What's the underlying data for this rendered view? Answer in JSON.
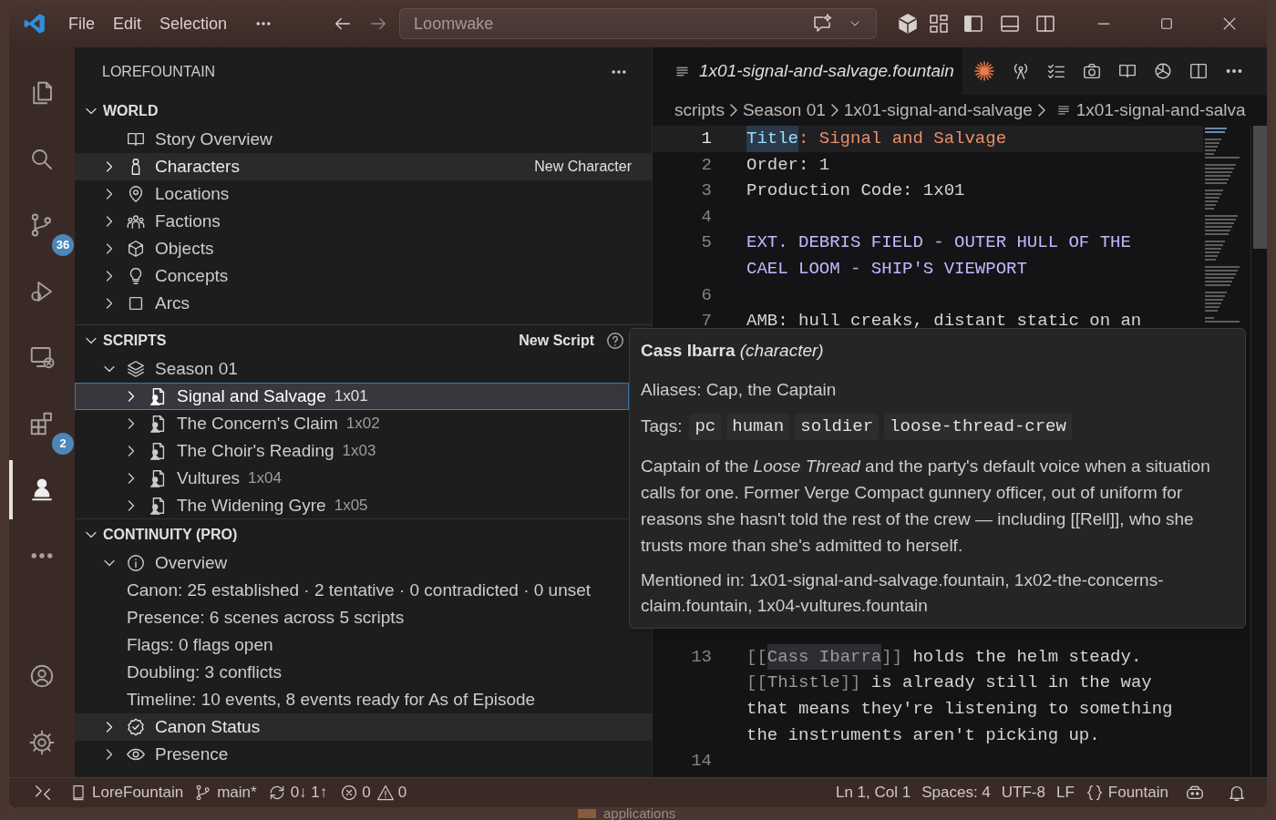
{
  "title_bar": {
    "menus": [
      "File",
      "Edit",
      "Selection"
    ],
    "search": "Loomwake"
  },
  "activity_bar": {
    "items": [
      {
        "kind": "explorer",
        "selected": false
      },
      {
        "kind": "search",
        "selected": false
      },
      {
        "kind": "source_control",
        "selected": false,
        "badge": "36"
      },
      {
        "kind": "run",
        "selected": false
      },
      {
        "kind": "remote",
        "selected": false
      },
      {
        "kind": "extensions",
        "selected": false,
        "badge": "2"
      },
      {
        "kind": "lorefountain",
        "selected": true
      },
      {
        "kind": "more",
        "selected": false
      }
    ],
    "bottom": [
      {
        "kind": "accounts"
      },
      {
        "kind": "settings"
      }
    ]
  },
  "sidebar": {
    "title": "LOREFOUNTAIN",
    "sections": [
      {
        "title": "WORLD",
        "expanded": true,
        "items": [
          {
            "kind": "overview",
            "label": "Story Overview",
            "hovered": false
          },
          {
            "kind": "characters",
            "label": "Characters",
            "expanded": false,
            "hovered": true,
            "action": "New Character"
          },
          {
            "kind": "locations",
            "label": "Locations",
            "expanded": false,
            "hovered": false
          },
          {
            "kind": "factions",
            "label": "Factions",
            "expanded": false,
            "hovered": false
          },
          {
            "kind": "objects",
            "label": "Objects",
            "expanded": false,
            "hovered": false
          },
          {
            "kind": "concepts",
            "label": "Concepts",
            "expanded": false,
            "hovered": false
          },
          {
            "kind": "arcs",
            "label": "Arcs",
            "expanded": false,
            "hovered": false
          }
        ]
      },
      {
        "title": "SCRIPTS",
        "expanded": true,
        "action": "New Script",
        "items": [
          {
            "kind": "season",
            "label": "Season 01",
            "expanded": true,
            "hovered": false,
            "children": [
              {
                "kind": "script",
                "label": "Signal and Salvage",
                "code": "1x01",
                "expanded": false,
                "selected": true
              },
              {
                "kind": "script",
                "label": "The Concern's Claim",
                "code": "1x02",
                "expanded": false,
                "selected": false
              },
              {
                "kind": "script",
                "label": "The Choir's Reading",
                "code": "1x03",
                "expanded": false,
                "selected": false
              },
              {
                "kind": "script",
                "label": "Vultures",
                "code": "1x04",
                "expanded": false,
                "selected": false
              },
              {
                "kind": "script",
                "label": "The Widening Gyre",
                "code": "1x05",
                "expanded": false,
                "selected": false
              }
            ]
          }
        ]
      },
      {
        "title": "CONTINUITY (PRO)",
        "expanded": true,
        "items": [
          {
            "kind": "overview_stats",
            "label": "Overview",
            "expanded": true,
            "hovered": false,
            "children": [
              {
                "kind": "stat",
                "label": "Canon: 25 established · 2 tentative · 0 contradicted · 0 unset"
              },
              {
                "kind": "stat",
                "label": "Presence: 6 scenes across 5 scripts"
              },
              {
                "kind": "stat",
                "label": "Flags: 0 flags open"
              },
              {
                "kind": "stat",
                "label": "Doubling: 3 conflicts"
              },
              {
                "kind": "stat",
                "label": "Timeline: 10 events, 8 events ready for As of Episode"
              }
            ]
          },
          {
            "kind": "canon",
            "label": "Canon Status",
            "expanded": false,
            "hovered": true
          },
          {
            "kind": "presence",
            "label": "Presence",
            "expanded": false,
            "hovered": false
          }
        ]
      }
    ]
  },
  "editor": {
    "tab": {
      "label": "1x01-signal-and-salvage.fountain",
      "preview": true
    },
    "breadcrumbs": [
      "scripts",
      "Season 01",
      "1x01-signal-and-salvage",
      "1x01-signal-and-salva"
    ],
    "rows_top": [
      {
        "number": "1",
        "current": true,
        "tokens": [
          {
            "kind": "key_highlighted",
            "text": "Title"
          },
          {
            "kind": "value",
            "text": ": Signal and Salvage"
          }
        ]
      },
      {
        "number": "2",
        "current": false,
        "tokens": [
          {
            "kind": "plain",
            "text": "Order: 1"
          }
        ]
      },
      {
        "number": "3",
        "current": false,
        "tokens": [
          {
            "kind": "plain",
            "text": "Production Code: 1x01"
          }
        ]
      },
      {
        "number": "4",
        "current": false
      },
      {
        "number": "5",
        "current": false,
        "tokens": [
          {
            "kind": "heading",
            "text": "EXT. DEBRIS FIELD - OUTER HULL OF THE"
          }
        ]
      },
      {
        "tokens": [
          {
            "kind": "heading",
            "text": "CAEL LOOM - SHIP'S VIEWPORT"
          }
        ]
      },
      {
        "number": "6",
        "current": false
      },
      {
        "number": "7",
        "current": false,
        "tokens": [
          {
            "kind": "plain",
            "text": "AMB: hull creaks, distant static on an"
          }
        ]
      }
    ],
    "rows_bottom": [
      {
        "number": "13",
        "current": false,
        "tokens": [
          {
            "kind": "bracket",
            "text": "[["
          },
          {
            "kind": "link_highlighted",
            "text": "Cass Ibarra"
          },
          {
            "kind": "bracket",
            "text": "]]"
          },
          {
            "kind": "plain",
            "text": " holds the helm steady."
          }
        ]
      },
      {
        "tokens": [
          {
            "kind": "bracket",
            "text": "[["
          },
          {
            "kind": "link",
            "text": "Thistle"
          },
          {
            "kind": "bracket",
            "text": "]]"
          },
          {
            "kind": "plain",
            "text": " is already still in the way"
          }
        ]
      },
      {
        "tokens": [
          {
            "kind": "plain",
            "text": "that means they're listening to something"
          }
        ]
      },
      {
        "tokens": [
          {
            "kind": "plain",
            "text": "the instruments aren't picking up."
          }
        ]
      },
      {
        "number": "14",
        "current": false
      }
    ]
  },
  "hover": {
    "title": "**Cass Ibarra** *(character)*",
    "aliases": "Aliases: Cap, the Captain",
    "tags_label": "Tags:",
    "tags": [
      "pc",
      "human",
      "soldier",
      "loose-thread-crew"
    ],
    "description": "Captain of the *Loose Thread* and the party's default voice when a situation calls for one. Former Verge Compact gunnery officer, out of uniform for reasons she hasn't told the rest of the crew — including [[Rell]], who she trusts more than she's admitted to herself.",
    "mentions": "Mentioned in: 1x01-signal-and-salvage.fountain, 1x02-the-concerns-claim.fountain, 1x04-vultures.fountain"
  },
  "status_bar": {
    "left": [
      {
        "kind": "remote"
      },
      {
        "kind": "project",
        "text": "LoreFountain"
      },
      {
        "kind": "branch",
        "text": "main*"
      },
      {
        "kind": "sync",
        "text": "0↓ 1↑"
      },
      {
        "kind": "problems",
        "errors": "0",
        "warnings": "0"
      }
    ],
    "right": [
      {
        "kind": "text",
        "text": "Ln 1, Col 1"
      },
      {
        "kind": "text",
        "text": "Spaces: 4"
      },
      {
        "kind": "text",
        "text": "UTF-8"
      },
      {
        "kind": "text",
        "text": "LF"
      },
      {
        "kind": "language",
        "text": "Fountain"
      },
      {
        "kind": "copilot"
      },
      {
        "kind": "bell"
      }
    ]
  },
  "desktop": {
    "label": "applications"
  }
}
